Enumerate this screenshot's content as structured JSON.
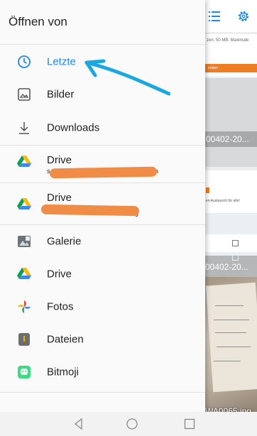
{
  "drawer": {
    "title": "Öffnen von",
    "items": [
      {
        "label": "Letzte",
        "icon": "clock-icon",
        "active": true
      },
      {
        "label": "Bilder",
        "icon": "image-icon"
      },
      {
        "label": "Downloads",
        "icon": "download-icon"
      },
      {
        "label": "Drive",
        "sub": "s",
        "sub_tail": "n",
        "icon": "google-drive-icon"
      },
      {
        "label": "Drive",
        "sub": "",
        "sub_tail": "g",
        "icon": "google-drive-icon"
      },
      {
        "label": "Galerie",
        "icon": "gallery-app-icon"
      },
      {
        "label": "Drive",
        "icon": "google-drive-icon"
      },
      {
        "label": "Fotos",
        "icon": "google-photos-icon"
      },
      {
        "label": "Dateien",
        "icon": "files-app-icon"
      },
      {
        "label": "Bitmoji",
        "icon": "bitmoji-icon"
      }
    ]
  },
  "background": {
    "note1": "zen. 50 MB. Maximale",
    "banner": "ersten",
    "file1": "00402-20...",
    "note2": "en Austausch für alle!",
    "file2": "00402-20...",
    "file3": "WA0065.jpg"
  },
  "colors": {
    "accent": "#1e88e5",
    "redaction": "#f08c46",
    "annotation_arrow": "#1ba8e0"
  }
}
